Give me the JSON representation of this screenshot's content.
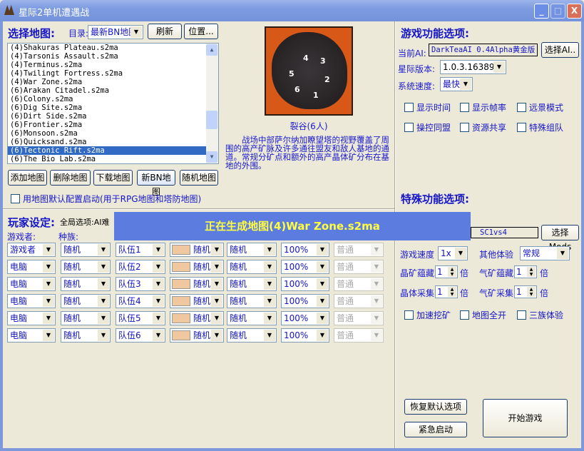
{
  "window": {
    "title": "星际2单机遭遇战",
    "minimize": "_",
    "maximize": "□",
    "close": "X"
  },
  "map_select": {
    "heading": "选择地图:",
    "dir_label": "目录:",
    "dir_value": "最新BN地图",
    "refresh": "刷新",
    "location": "位置...",
    "maps": [
      "(4)Shakuras Plateau.s2ma",
      "(4)Tarsonis Assault.s2ma",
      "(4)Terminus.s2ma",
      "(4)Twilingt Fortress.s2ma",
      "(4)War Zone.s2ma",
      "(6)Arakan Citadel.s2ma",
      "(6)Colony.s2ma",
      "(6)Dig Site.s2ma",
      "(6)Dirt Side.s2ma",
      "(6)Frontier.s2ma",
      "(6)Monsoon.s2ma",
      "(6)Quicksand.s2ma",
      "(6)Tectonic Rift.s2ma",
      "(6)The Bio Lab.s2ma"
    ],
    "selected_index": 12,
    "buttons": [
      "添加地图",
      "删除地图",
      "下载地图",
      "新BN地图",
      "随机地图"
    ],
    "default_config": "用地图默认配置启动(用于RPG地图和塔防地图)"
  },
  "preview": {
    "markers": [
      "4",
      "3",
      "5",
      "2",
      "6",
      "1"
    ],
    "name": "裂谷(6人)",
    "description": "战场中部萨尔纳加瞭望塔的视野覆盖了周围的高产矿脉及许多通往盟友和敌人基地的通道。常规分矿点和额外的高产晶体矿分布在基地的外围。"
  },
  "players": {
    "heading": "玩家设定:",
    "global_label": "全局选项:AI难",
    "col_player": "游戏者:",
    "col_race": "种族:",
    "rows": [
      {
        "player": "游戏者",
        "race": "随机",
        "team": "队伍1",
        "color": "随机",
        "start": "随机",
        "handicap": "100%",
        "difficulty": "普通"
      },
      {
        "player": "电脑",
        "race": "随机",
        "team": "队伍2",
        "color": "随机",
        "start": "随机",
        "handicap": "100%",
        "difficulty": "普通"
      },
      {
        "player": "电脑",
        "race": "随机",
        "team": "队伍3",
        "color": "随机",
        "start": "随机",
        "handicap": "100%",
        "difficulty": "普通"
      },
      {
        "player": "电脑",
        "race": "随机",
        "team": "队伍4",
        "color": "随机",
        "start": "随机",
        "handicap": "100%",
        "difficulty": "普通"
      },
      {
        "player": "电脑",
        "race": "随机",
        "team": "队伍5",
        "color": "随机",
        "start": "随机",
        "handicap": "100%",
        "difficulty": "普通"
      },
      {
        "player": "电脑",
        "race": "随机",
        "team": "队伍6",
        "color": "随机",
        "start": "随机",
        "handicap": "100%",
        "difficulty": "普通"
      }
    ],
    "swatch_color": "#f0c8a0"
  },
  "overlay": {
    "text": "正在生成地图(4)War Zone.s2ma"
  },
  "game_options": {
    "heading": "游戏功能选项:",
    "ai_label": "当前AI:",
    "ai_value": "DarkTeaAI 0.4Alpha黄金版",
    "select_ai": "选择AI..",
    "version_label": "星际版本:",
    "version_value": "1.0.3.16389",
    "speed_label": "系统速度:",
    "speed_value": "最快",
    "checks": [
      "显示时间",
      "显示帧率",
      "远景模式",
      "操控同盟",
      "资源共享",
      "特殊组队"
    ]
  },
  "special": {
    "heading": "特殊功能选项:",
    "mod_value": "SC1vs4",
    "select_mods": "选择Mods",
    "game_speed_label": "游戏速度",
    "game_speed": "1x",
    "other_label": "其他体验",
    "other_value": "常规",
    "mineral_store_label": "晶矿蕴藏",
    "mineral_store": "1",
    "gas_store_label": "气矿蕴藏",
    "gas_store": "1",
    "mineral_gather_label": "晶体采集",
    "mineral_gather": "1",
    "gas_gather_label": "气矿采集",
    "gas_gather": "1",
    "unit": "倍",
    "checks": [
      "加速挖矿",
      "地图全开",
      "三族体验"
    ]
  },
  "actions": {
    "restore": "恢复默认选项",
    "emergency": "紧急启动",
    "start": "开始游戏"
  }
}
